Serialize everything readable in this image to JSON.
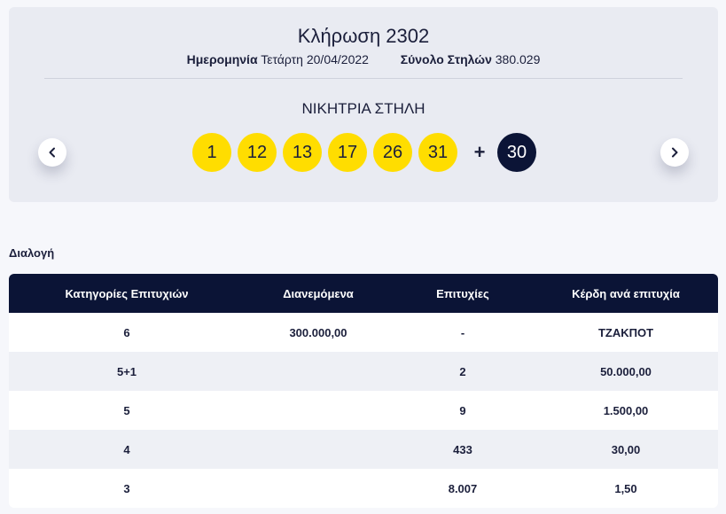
{
  "draw": {
    "title": "Κλήρωση 2302",
    "date_label": "Ημερομηνία",
    "date_value": "Τετάρτη 20/04/2022",
    "columns_label": "Σύνολο Στηλών",
    "columns_value": "380.029"
  },
  "winning": {
    "title": "ΝΙΚΗΤΡΙΑ ΣΤΗΛΗ",
    "numbers": [
      "1",
      "12",
      "13",
      "17",
      "26",
      "31"
    ],
    "plus": "+",
    "bonus": "30"
  },
  "nav": {
    "prev_icon": "chevron-left-icon",
    "next_icon": "chevron-right-icon"
  },
  "section": {
    "label": "Διαλογή"
  },
  "table": {
    "headers": [
      "Κατηγορίες Επιτυχιών",
      "Διανεμόμενα",
      "Επιτυχίες",
      "Κέρδη ανά επιτυχία"
    ],
    "rows": [
      [
        "6",
        "300.000,00",
        "-",
        "ΤΖΑΚΠΟΤ"
      ],
      [
        "5+1",
        "",
        "2",
        "50.000,00"
      ],
      [
        "5",
        "",
        "9",
        "1.500,00"
      ],
      [
        "4",
        "",
        "433",
        "30,00"
      ],
      [
        "3",
        "",
        "8.007",
        "1,50"
      ]
    ]
  },
  "colors": {
    "ball": "#ffdd00",
    "bonus_ball": "#0b1436",
    "header_bg": "#0b1436",
    "card_bg": "#e9ebf2"
  }
}
